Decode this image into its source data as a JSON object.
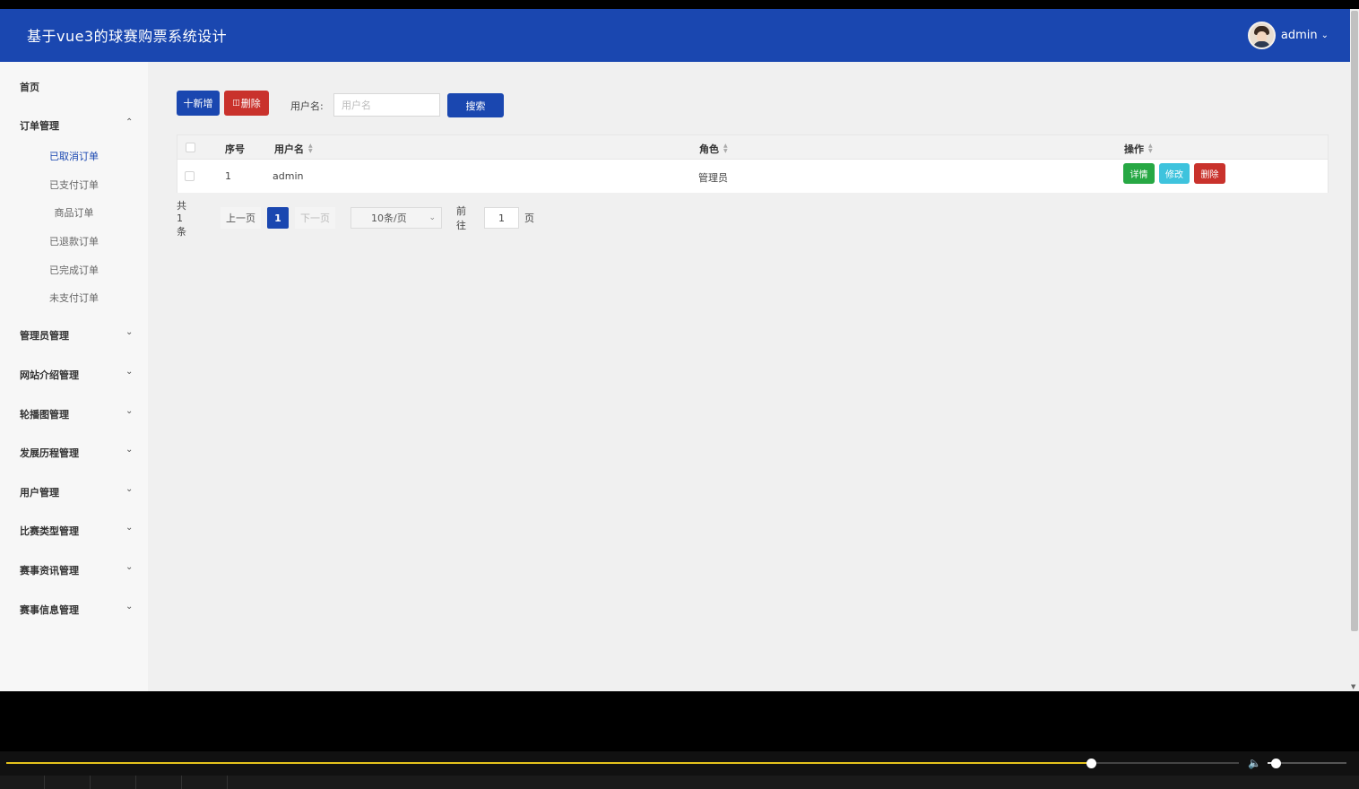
{
  "app": {
    "title": "基于vue3的球赛购票系统设计"
  },
  "user": {
    "name": "admin"
  },
  "sidebar": {
    "home": "首页",
    "order_group": "订单管理",
    "order_items": [
      "已取消订单",
      "已支付订单",
      "商品订单",
      "已退款订单",
      "已完成订单",
      "未支付订单"
    ],
    "groups": [
      "管理员管理",
      "网站介绍管理",
      "轮播图管理",
      "发展历程管理",
      "用户管理",
      "比赛类型管理",
      "赛事资讯管理",
      "赛事信息管理"
    ]
  },
  "toolbar": {
    "add_label": "十新增",
    "delete_label": "删除",
    "search_label": "用户名:",
    "search_placeholder": "用户名",
    "search_button": "搜索"
  },
  "table": {
    "headers": {
      "index": "序号",
      "username": "用户名",
      "role": "角色",
      "actions": "操作"
    },
    "rows": [
      {
        "index": "1",
        "username": "admin",
        "role": "管理员"
      }
    ],
    "actions": {
      "detail": "详情",
      "edit": "修改",
      "delete": "删除"
    }
  },
  "pagination": {
    "total": "共 1 条",
    "prev": "上一页",
    "current": "1",
    "next": "下一页",
    "page_size": "10条/页",
    "goto": "前往",
    "goto_value": "1",
    "unit": "页"
  },
  "player": {
    "progress": 0.88,
    "volume": 0.1
  },
  "colors": {
    "primary": "#1a47b0",
    "danger": "#c9322c",
    "success": "#27a844",
    "info": "#3ec3dd",
    "progress": "#e4c21d"
  }
}
